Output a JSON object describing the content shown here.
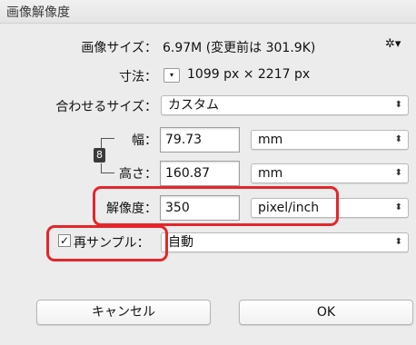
{
  "window": {
    "title": "画像解像度"
  },
  "image_size": {
    "label": "画像サイズ：",
    "value": "6.97M (変更前は 301.9K)"
  },
  "settings_icon": "✲▾",
  "dimensions": {
    "label": "寸法：",
    "dropdown_glyph": "▾",
    "value": "1099 px × 2217 px"
  },
  "fit_to": {
    "label": "合わせるサイズ：",
    "value": "カスタム"
  },
  "width": {
    "label": "幅：",
    "value": "79.73",
    "unit": "mm"
  },
  "height": {
    "label": "高さ：",
    "value": "160.87",
    "unit": "mm"
  },
  "resolution": {
    "label": "解像度：",
    "value": "350",
    "unit": "pixel/inch"
  },
  "resample": {
    "checked_glyph": "✓",
    "label": "再サンプル：",
    "value": "自動"
  },
  "buttons": {
    "cancel": "キャンセル",
    "ok": "OK"
  },
  "select_arrow": "⬍",
  "chain_glyph": "8",
  "colors": {
    "highlight": "#e4262b"
  }
}
